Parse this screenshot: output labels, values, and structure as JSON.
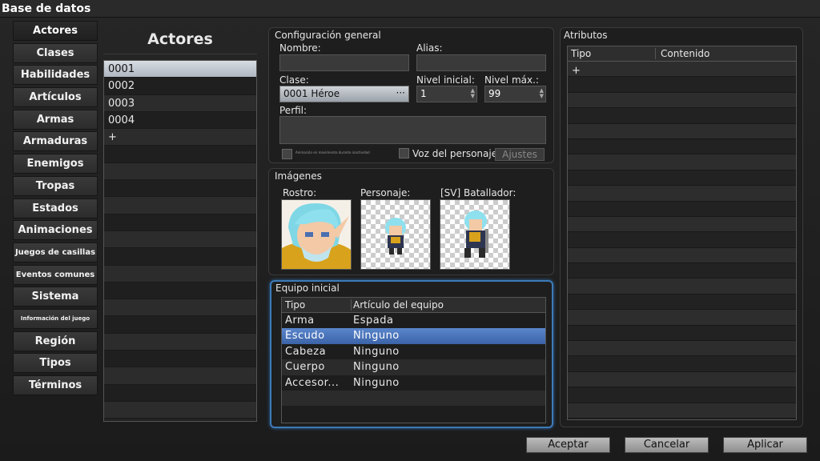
{
  "window": {
    "title": "Base de datos"
  },
  "categories": [
    {
      "label": "Actores",
      "sel": true
    },
    {
      "label": "Clases"
    },
    {
      "label": "Habilidades"
    },
    {
      "label": "Artículos"
    },
    {
      "label": "Armas"
    },
    {
      "label": "Armaduras"
    },
    {
      "label": "Enemigos"
    },
    {
      "label": "Tropas"
    },
    {
      "label": "Estados"
    },
    {
      "label": "Animaciones"
    },
    {
      "label": "Juegos de casillas",
      "size": "sm"
    },
    {
      "label": "Eventos comunes",
      "size": "sm"
    },
    {
      "label": "Sistema"
    },
    {
      "label": "Información del juego",
      "size": "xs"
    },
    {
      "label": "Región"
    },
    {
      "label": "Tipos"
    },
    {
      "label": "Términos"
    }
  ],
  "actors": {
    "title": "Actores",
    "items": [
      "0001",
      "0002",
      "0003",
      "0004",
      "+"
    ],
    "selected": "0001"
  },
  "general": {
    "title": "Configuración general",
    "name_label": "Nombre:",
    "name_value": "",
    "alias_label": "Alias:",
    "alias_value": "",
    "class_label": "Clase:",
    "class_value": "0001 Héroe",
    "class_btn": "···",
    "level_label": "Nivel inicial:",
    "level_value": "1",
    "maxlevel_label": "Nivel máx.:",
    "maxlevel_value": "99",
    "profile_label": "Perfil:",
    "profile_value": "",
    "small_option": "Animación en movimiento durante inactividad",
    "voice_label": "Voz del personaje",
    "settings_btn": "Ajustes"
  },
  "images": {
    "title": "Imágenes",
    "face": "Rostro:",
    "character": "Personaje:",
    "battler": "[SV] Batallador:"
  },
  "equip": {
    "title": "Equipo inicial",
    "col_type": "Tipo",
    "col_item": "Artículo del equipo",
    "rows": [
      {
        "type": "Arma",
        "item": "Espada"
      },
      {
        "type": "Escudo",
        "item": "Ninguno",
        "sel": true
      },
      {
        "type": "Cabeza",
        "item": "Ninguno"
      },
      {
        "type": "Cuerpo",
        "item": "Ninguno"
      },
      {
        "type": "Accesor...",
        "item": "Ninguno"
      }
    ]
  },
  "attributes": {
    "title": "Atributos",
    "col_type": "Tipo",
    "col_content": "Contenido",
    "add": "+"
  },
  "buttons": {
    "ok": "Aceptar",
    "cancel": "Cancelar",
    "apply": "Aplicar"
  }
}
